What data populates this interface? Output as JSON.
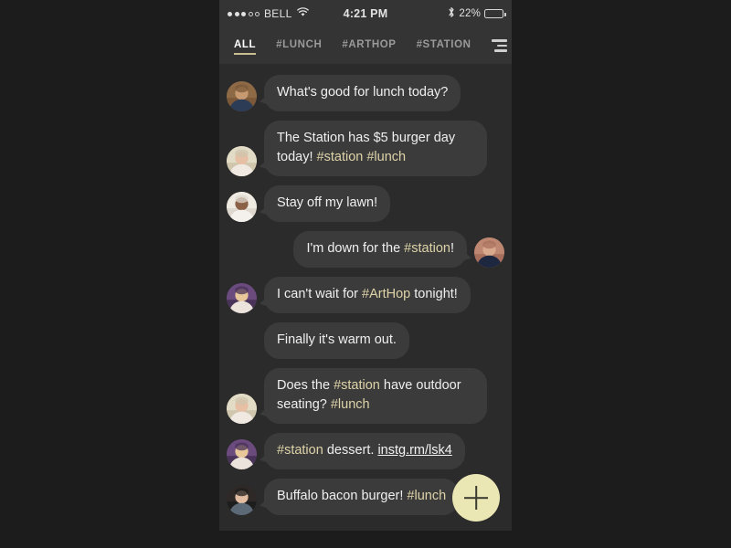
{
  "statusbar": {
    "signal_filled": 3,
    "signal_empty": 2,
    "carrier": "BELL",
    "wifi_icon": "wifi-icon",
    "time": "4:21 PM",
    "bluetooth_icon": "bluetooth-icon",
    "battery_percent": "22%",
    "battery_level": 22
  },
  "tabbar": {
    "tabs": [
      {
        "label": "ALL",
        "active": true
      },
      {
        "label": "#LUNCH",
        "active": false
      },
      {
        "label": "#ARTHOP",
        "active": false
      },
      {
        "label": "#STATION",
        "active": false
      }
    ],
    "menu_icon": "hamburger-menu-icon"
  },
  "chat": {
    "messages": [
      {
        "id": 1,
        "side": "left",
        "avatar": "bearded-man-blue-shirt",
        "show_avatar": true,
        "parts": [
          {
            "t": "What's good for lunch today?",
            "k": "text"
          }
        ]
      },
      {
        "id": 2,
        "side": "left",
        "avatar": "person-sunglasses",
        "show_avatar": true,
        "parts": [
          {
            "t": "The Station has $5 burger day today! ",
            "k": "text"
          },
          {
            "t": "#station",
            "k": "tag"
          },
          {
            "t": " ",
            "k": "text"
          },
          {
            "t": "#lunch",
            "k": "tag"
          }
        ]
      },
      {
        "id": 3,
        "side": "left",
        "avatar": "man-white-shirt",
        "show_avatar": true,
        "parts": [
          {
            "t": "Stay off my lawn!",
            "k": "text"
          }
        ]
      },
      {
        "id": 4,
        "side": "right",
        "avatar": "man-navy-brick",
        "show_avatar": true,
        "parts": [
          {
            "t": "I'm down for the ",
            "k": "text"
          },
          {
            "t": "#station",
            "k": "tag"
          },
          {
            "t": "!",
            "k": "text"
          }
        ]
      },
      {
        "id": 5,
        "side": "left",
        "avatar": "blonde-woman-floral",
        "show_avatar": true,
        "parts": [
          {
            "t": "I can't wait for ",
            "k": "text"
          },
          {
            "t": "#ArtHop",
            "k": "tag"
          },
          {
            "t": " tonight!",
            "k": "text"
          }
        ]
      },
      {
        "id": 6,
        "side": "left",
        "avatar": "blonde-woman-floral",
        "show_avatar": false,
        "parts": [
          {
            "t": "Finally it's warm out.",
            "k": "text"
          }
        ]
      },
      {
        "id": 7,
        "side": "left",
        "avatar": "person-sunglasses",
        "show_avatar": true,
        "parts": [
          {
            "t": "Does the ",
            "k": "text"
          },
          {
            "t": "#station",
            "k": "tag"
          },
          {
            "t": " have outdoor seating? ",
            "k": "text"
          },
          {
            "t": "#lunch",
            "k": "tag"
          }
        ]
      },
      {
        "id": 8,
        "side": "left",
        "avatar": "blonde-woman-floral",
        "show_avatar": true,
        "parts": [
          {
            "t": "#station",
            "k": "tag"
          },
          {
            "t": " dessert. ",
            "k": "text"
          },
          {
            "t": "instg.rm/lsk4",
            "k": "link"
          }
        ]
      },
      {
        "id": 9,
        "side": "left",
        "avatar": "dark-hair-woman",
        "show_avatar": true,
        "parts": [
          {
            "t": "Buffalo bacon burger! ",
            "k": "text"
          },
          {
            "t": "#lunch",
            "k": "tag"
          }
        ]
      }
    ],
    "compose_button": "+"
  },
  "colors": {
    "background": "#1c1c1c",
    "screen": "#2b2b2b",
    "header": "#343434",
    "bubble": "#3b3b3b",
    "text": "#efefef",
    "hashtag": "#ded3a8",
    "accent": "#ebe7b4",
    "tab_inactive": "#9a9a9a"
  }
}
